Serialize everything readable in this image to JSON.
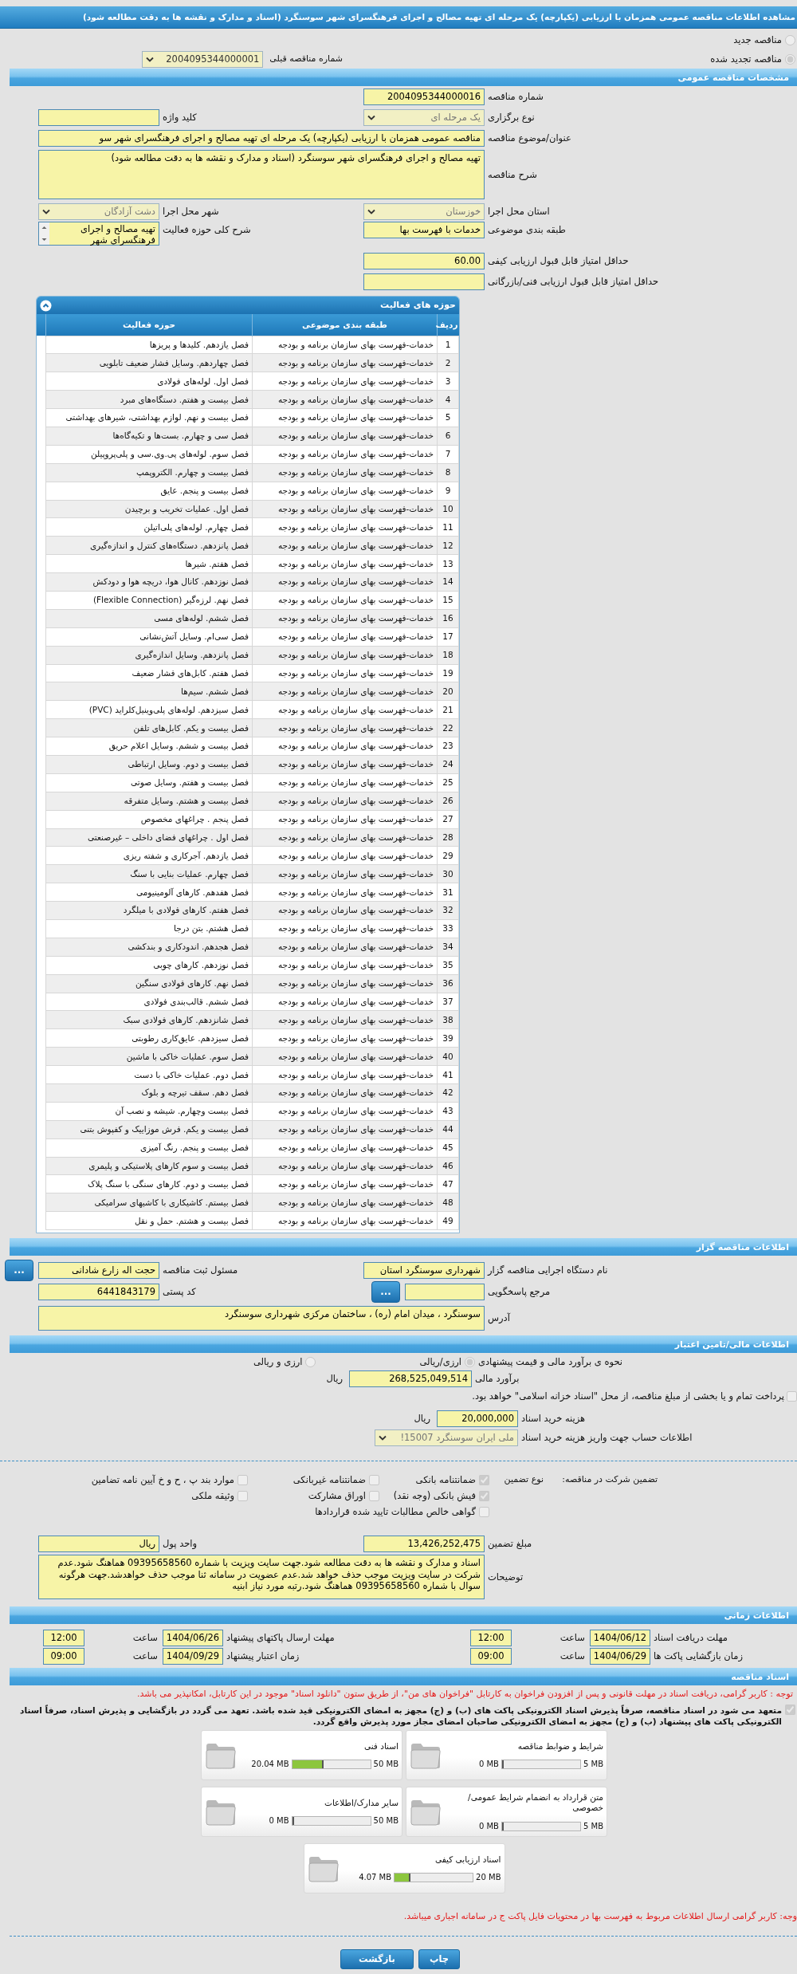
{
  "page_title": "مشاهده اطلاعات مناقصه عمومی همزمان با ارزیابی (یکپارچه) یک مرحله ای تهیه مصالح و اجرای فرهنگسرای شهر سوسنگرد (اسناد و مدارک و نقشه ها به دقت مطالعه شود)",
  "tender_status": {
    "options": [
      {
        "label": "مناقصه جدید",
        "selected": false
      },
      {
        "label": "مناقصه تجدید شده",
        "selected": true
      }
    ],
    "previous_number": {
      "label": "شماره مناقصه قبلی",
      "kind": "select",
      "value": "2004095344000001"
    }
  },
  "general": {
    "title": "مشخصات مناقصه عمومی",
    "fields": [
      {
        "label": "شماره مناقصه",
        "kind": "input",
        "value": "2004095344000016"
      },
      {
        "label": "نوع برگزاری",
        "kind": "select",
        "value": "یک مرحله ای"
      },
      {
        "label": "کلید واژه",
        "kind": "input"
      },
      {
        "label": "عنوان/موضوع مناقصه",
        "kind": "input",
        "value": "مناقصه عمومی همزمان با ارزیابی (یکپارچه) یک مرحله ای تهیه مصالح و اجرای فرهنگسرای شهر سو"
      },
      {
        "label": "شرح مناقصه",
        "kind": "textarea",
        "value": "تهیه مصالح و اجرای فرهنگسرای شهر سوسنگرد (اسناد و مدارک و نقشه ها به دقت مطالعه شود)"
      },
      {
        "label": "استان محل اجرا",
        "kind": "select",
        "value": "خوزستان"
      },
      {
        "label": "شهر محل اجرا",
        "kind": "select",
        "value": "دشت آزادگان"
      },
      {
        "label": "طبقه بندی موضوعی",
        "kind": "input",
        "value": "خدمات با فهرست بها"
      },
      {
        "label": "شرح کلی حوزه فعالیت",
        "kind": "scroll",
        "value": "تهیه مصالح و اجرای فرهنگسرای شهر"
      },
      {
        "label": "حداقل امتیاز قابل قبول ارزیابی کیفی",
        "kind": "input",
        "value": "60.00"
      },
      {
        "label": "حداقل امتیاز قابل قبول ارزیابی فنی/بازرگانی",
        "kind": "input"
      }
    ]
  },
  "activities": {
    "title": "حوزه های فعالیت",
    "columns": [
      "ردیف",
      "طبقه بندی موضوعی",
      "حوزه فعالیت"
    ],
    "rows": [
      [
        "1",
        "خدمات-فهرست بهای سازمان برنامه و بودجه",
        "فصل یازدهم. کلیدها و پریزها"
      ],
      [
        "2",
        "خدمات-فهرست بهای سازمان برنامه و بودجه",
        "فصل چهاردهم. وسایل فشار ضعیف تابلویی"
      ],
      [
        "3",
        "خدمات-فهرست بهای سازمان برنامه و بودجه",
        "فصل اول. لوله‌های فولادی"
      ],
      [
        "4",
        "خدمات-فهرست بهای سازمان برنامه و بودجه",
        "فصل بیست و هفتم. دستگاه‌های مبرد"
      ],
      [
        "5",
        "خدمات-فهرست بهای سازمان برنامه و بودجه",
        "فصل بیست و نهم. لوازم بهداشتی، شیرهای بهداشتی"
      ],
      [
        "6",
        "خدمات-فهرست بهای سازمان برنامه و بودجه",
        "فصل سی و چهارم. بست‌ها و تکیه‌گاه‌ها"
      ],
      [
        "7",
        "خدمات-فهرست بهای سازمان برنامه و بودجه",
        "فصل سوم. لوله‌های پی.وی.سی و پلی‌پروپیلن"
      ],
      [
        "8",
        "خدمات-فهرست بهای سازمان برنامه و بودجه",
        "فصل بیست و چهارم. الکتروپمپ"
      ],
      [
        "9",
        "خدمات-فهرست بهای سازمان برنامه و بودجه",
        "فصل بیست و پنجم. عایق"
      ],
      [
        "10",
        "خدمات-فهرست بهای سازمان برنامه و بودجه",
        "فصل اول. عملیات تخریب و برچیدن"
      ],
      [
        "11",
        "خدمات-فهرست بهای سازمان برنامه و بودجه",
        "فصل چهارم. لوله‌های پلی‌اتیلن"
      ],
      [
        "12",
        "خدمات-فهرست بهای سازمان برنامه و بودجه",
        "فصل پانزدهم. دستگاه‌های کنترل و اندازه‌گیری"
      ],
      [
        "13",
        "خدمات-فهرست بهای سازمان برنامه و بودجه",
        "فصل هفتم. شیرها"
      ],
      [
        "14",
        "خدمات-فهرست بهای سازمان برنامه و بودجه",
        "فصل نوزدهم. کانال هوا، دریچه هوا و دودکش"
      ],
      [
        "15",
        "خدمات-فهرست بهای سازمان برنامه و بودجه",
        "فصل نهم. لرزه‌گیر (Flexible Connection)"
      ],
      [
        "16",
        "خدمات-فهرست بهای سازمان برنامه و بودجه",
        "فصل ششم. لوله‌های مسی"
      ],
      [
        "17",
        "خدمات-فهرست بهای سازمان برنامه و بودجه",
        "فصل سی‌ام. وسایل آتش‌نشانی"
      ],
      [
        "18",
        "خدمات-فهرست بهای سازمان برنامه و بودجه",
        "فصل پانزدهم. وسایل اندازه‌گیری"
      ],
      [
        "19",
        "خدمات-فهرست بهای سازمان برنامه و بودجه",
        "فصل هفتم. کابل‌های فشار ضعیف"
      ],
      [
        "20",
        "خدمات-فهرست بهای سازمان برنامه و بودجه",
        "فصل ششم. سیم‌ها"
      ],
      [
        "21",
        "خدمات-فهرست بهای سازمان برنامه و بودجه",
        "فصل سیزدهم. لوله‌های پلی‌وینیل‌کلراید (PVC)"
      ],
      [
        "22",
        "خدمات-فهرست بهای سازمان برنامه و بودجه",
        "فصل بیست و یکم. کابل‌های تلفن"
      ],
      [
        "23",
        "خدمات-فهرست بهای سازمان برنامه و بودجه",
        "فصل بیست و ششم. وسایل اعلام حریق"
      ],
      [
        "24",
        "خدمات-فهرست بهای سازمان برنامه و بودجه",
        "فصل بیست و دوم. وسایل ارتباطی"
      ],
      [
        "25",
        "خدمات-فهرست بهای سازمان برنامه و بودجه",
        "فصل بیست و هفتم. وسایل صوتی"
      ],
      [
        "26",
        "خدمات-فهرست بهای سازمان برنامه و بودجه",
        "فصل بیست و هشتم. وسایل متفرقه"
      ],
      [
        "27",
        "خدمات-فهرست بهای سازمان برنامه و بودجه",
        "فصل پنجم . چراغهای مخصوص"
      ],
      [
        "28",
        "خدمات-فهرست بهای سازمان برنامه و بودجه",
        "فصل اول . چراغهای فضای داخلی – غیرصنعتی"
      ],
      [
        "29",
        "خدمات-فهرست بهای سازمان برنامه و بودجه",
        "فصل یازدهم. آجرکاری و شفته ریزی"
      ],
      [
        "30",
        "خدمات-فهرست بهای سازمان برنامه و بودجه",
        "فصل چهارم. عملیات بنایی با سنگ"
      ],
      [
        "31",
        "خدمات-فهرست بهای سازمان برنامه و بودجه",
        "فصل هفدهم. کارهای آلومینیومی"
      ],
      [
        "32",
        "خدمات-فهرست بهای سازمان برنامه و بودجه",
        "فصل هفتم. کارهای فولادی با میلگرد"
      ],
      [
        "33",
        "خدمات-فهرست بهای سازمان برنامه و بودجه",
        "فصل هشتم. بتن درجا"
      ],
      [
        "34",
        "خدمات-فهرست بهای سازمان برنامه و بودجه",
        "فصل هجدهم. اندودکاری و بندکشی"
      ],
      [
        "35",
        "خدمات-فهرست بهای سازمان برنامه و بودجه",
        "فصل نوزدهم. کارهای چوبی"
      ],
      [
        "36",
        "خدمات-فهرست بهای سازمان برنامه و بودجه",
        "فصل نهم. کارهای فولادی سنگین"
      ],
      [
        "37",
        "خدمات-فهرست بهای سازمان برنامه و بودجه",
        "فصل ششم. قالب‌بندی فولادی"
      ],
      [
        "38",
        "خدمات-فهرست بهای سازمان برنامه و بودجه",
        "فصل شانزدهم. کارهای فولادی سبک"
      ],
      [
        "39",
        "خدمات-فهرست بهای سازمان برنامه و بودجه",
        "فصل سیزدهم. عایق‌کاری رطوبتی"
      ],
      [
        "40",
        "خدمات-فهرست بهای سازمان برنامه و بودجه",
        "فصل سوم. عملیات خاکی با ماشین"
      ],
      [
        "41",
        "خدمات-فهرست بهای سازمان برنامه و بودجه",
        "فصل دوم. عملیات خاکی با دست"
      ],
      [
        "42",
        "خدمات-فهرست بهای سازمان برنامه و بودجه",
        "فصل دهم. سقف تیرچه و بلوک"
      ],
      [
        "43",
        "خدمات-فهرست بهای سازمان برنامه و بودجه",
        "فصل بیست وچهارم. شیشه و نصب آن"
      ],
      [
        "44",
        "خدمات-فهرست بهای سازمان برنامه و بودجه",
        "فصل بیست و یکم. فرش موزاییک و کفپوش بتنی"
      ],
      [
        "45",
        "خدمات-فهرست بهای سازمان برنامه و بودجه",
        "فصل بیست و پنجم. رنگ آمیزی"
      ],
      [
        "46",
        "خدمات-فهرست بهای سازمان برنامه و بودجه",
        "فصل بیست و سوم کارهای پلاستیکی و پلیمری"
      ],
      [
        "47",
        "خدمات-فهرست بهای سازمان برنامه و بودجه",
        "فصل بیست و دوم. کارهای سنگی با سنگ پلاک"
      ],
      [
        "48",
        "خدمات-فهرست بهای سازمان برنامه و بودجه",
        "فصل بیستم. کاشیکاری با کاشیهای سرامیکی"
      ],
      [
        "49",
        "خدمات-فهرست بهای سازمان برنامه و بودجه",
        "فصل بیست و هشتم. حمل و نقل"
      ]
    ]
  },
  "organizer": {
    "title": "اطلاعات مناقصه گزار",
    "fields": [
      {
        "label": "نام دستگاه اجرایی مناقصه گزار",
        "kind": "input",
        "value": "شهرداری سوسنگرد استان"
      },
      {
        "label": "مسئول ثبت مناقصه",
        "kind": "input",
        "value": "حجت اله زارع شادانی",
        "button": "..."
      },
      {
        "label": "مرجع پاسخگویی",
        "kind": "input",
        "button": "..."
      },
      {
        "label": "کد پستی",
        "kind": "input",
        "value": "6441843179"
      },
      {
        "label": "آدرس",
        "kind": "textarea",
        "value": "سوسنگرد ، میدان امام (ره) ، ساختمان مرکزی شهرداری سوسنگرد"
      }
    ]
  },
  "finance": {
    "title": "اطلاعات مالی/تامین اعتبار",
    "estimate_method": {
      "label": "نحوه ی برآورد مالی و قیمت پیشنهادی",
      "options": [
        {
          "label": "ارزی/ریالی",
          "selected": true
        },
        {
          "label": "ارزی و ریالی",
          "selected": false
        }
      ]
    },
    "estimate": {
      "label": "برآورد مالی",
      "value": "268,525,049,514",
      "unit": "ریال"
    },
    "treasury": {
      "label": "پرداخت تمام و یا بخشی از مبلغ مناقصه، از محل \"اسناد خزانه اسلامی\" خواهد بود.",
      "checked": false
    },
    "document_fee": {
      "label": "هزینه خرید اسناد",
      "value": "20,000,000",
      "unit": "ریال"
    },
    "account": {
      "label": "اطلاعات حساب جهت واریز هزینه خرید اسناد",
      "value": "ملی ایران سوسنگرد 15007!"
    },
    "guarantee": {
      "label": "تضمین شرکت در مناقصه:",
      "type_label": "نوع تضمین",
      "options": [
        {
          "label": "ضمانتنامه بانکی",
          "checked": true
        },
        {
          "label": "ضمانتنامه غیربانکی",
          "checked": false
        },
        {
          "label": "موارد بند پ ، ح و خ آیین نامه تضامین",
          "checked": false
        },
        {
          "label": "فیش بانکی (وجه نقد)",
          "checked": true
        },
        {
          "label": "اوراق مشارکت",
          "checked": false
        },
        {
          "label": "وثیقه ملکی",
          "checked": false
        },
        {
          "label": "گواهی خالص مطالبات تایید شده قراردادها",
          "checked": false
        }
      ]
    },
    "guarantee_amount": {
      "label": "مبلغ تضمین",
      "value": "13,426,252,475"
    },
    "currency": {
      "label": "واحد پول",
      "value": "ریال"
    },
    "notes": {
      "label": "توضیحات",
      "value": "اسناد و مدارک و نقشه ها به دقت مطالعه شود.جهت سایت ویزیت با شماره 09395658560 هماهنگ شود.عدم شرکت در سایت ویزیت موجب حذف خواهد شد.عدم عضویت در سامانه ثنا موجب حذف خواهدشد.جهت هرگونه سوال با شماره 09395658560 هماهنگ شود.رتبه مورد نیاز ابنیه"
    }
  },
  "timing": {
    "title": "اطلاعات زمانی",
    "items": [
      {
        "label": "مهلت دریافت اسناد",
        "date": "1404/06/12",
        "time_label": "ساعت",
        "time": "12:00"
      },
      {
        "label": "مهلت ارسال پاکتهای پیشنهاد",
        "date": "1404/06/26",
        "time_label": "ساعت",
        "time": "12:00"
      },
      {
        "label": "زمان بازگشایی پاکت ها",
        "date": "1404/06/29",
        "time_label": "ساعت",
        "time": "09:00"
      },
      {
        "label": "زمان اعتبار پیشنهاد",
        "date": "1404/09/29",
        "time_label": "ساعت",
        "time": "09:00"
      }
    ]
  },
  "documents": {
    "title": "اسناد مناقصه",
    "notice": "توجه : کاربر گرامی، دریافت اسناد در مهلت قانونی و پس از افزودن فراخوان به کارتابل \"فراخوان های من\"، از طریق ستون \"دانلود اسناد\" موجود در این کارتابل، امکانپذیر می باشد.",
    "commitment": {
      "text": "متعهد می شود در اسناد مناقصه، صرفاً پذیرش اسناد الکترونیکی پاکت های (ب) و (ج) مجهز به امضای الکترونیکی قید شده باشد. تعهد می گردد در بازگشایی و پذیرش اسناد، صرفاً اسناد الکترونیکی پاکت های پیشنهاد (ب) و (ج) مجهز به امضای الکترونیکی صاحبان امضای مجاز مورد پذیرش واقع گردد.",
      "checked": true
    },
    "files": [
      {
        "title": "شرایط و ضوابط مناقصه",
        "used": "0 MB",
        "capacity": "5 MB",
        "level": 0
      },
      {
        "title": "اسناد فنی",
        "used": "20.04 MB",
        "capacity": "50 MB",
        "level": 0.4
      },
      {
        "title": "متن قرارداد به انضمام شرایط عمومی/خصوصی",
        "used": "0 MB",
        "capacity": "5 MB",
        "level": 0
      },
      {
        "title": "سایر مدارک/اطلاعات",
        "used": "0 MB",
        "capacity": "50 MB",
        "level": 0
      },
      {
        "title": "اسناد ارزیابی کیفی",
        "used": "4.07 MB",
        "capacity": "20 MB",
        "level": 0.2
      }
    ],
    "footer_notice": "وجه: کاربر گرامی ارسال اطلاعات مربوط به فهرست بها در محتویات فایل پاکت ج در سامانه اجباری میباشد.",
    "buttons": [
      "چاپ",
      "بازگشت"
    ]
  }
}
